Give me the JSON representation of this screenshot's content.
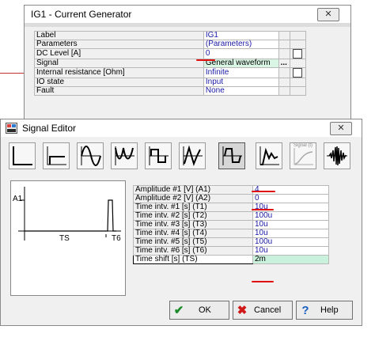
{
  "props_window": {
    "title": "IG1 - Current Generator",
    "rows": [
      {
        "label": "Label",
        "value": "IG1"
      },
      {
        "label": "Parameters",
        "value": "(Parameters)"
      },
      {
        "label": "DC Level [A]",
        "value": "0"
      },
      {
        "label": "Signal",
        "value": "General waveform",
        "more": "..."
      },
      {
        "label": "Internal resistance [Ohm]",
        "value": "Infinite"
      },
      {
        "label": "IO state",
        "value": "Input"
      },
      {
        "label": "Fault",
        "value": "None"
      }
    ]
  },
  "signal_editor": {
    "title": "Signal Editor",
    "waveform_buttons": [
      "step-waveform",
      "ramp-waveform",
      "sine-waveform",
      "full-wave-rectified",
      "square-waveform",
      "triangle-sawtooth-waveform",
      "general-pulse-waveform",
      "damped-waveform",
      "signal-file-waveform",
      "noise-burst-waveform"
    ],
    "signal_file_label": "Signal (t)",
    "active_button": 6,
    "preview": {
      "y_label": "A1",
      "x_label": "TS",
      "x_label_2": "T6"
    },
    "params": [
      {
        "label": "Amplitude #1 [V] (A1)",
        "value": "4"
      },
      {
        "label": "Amplitude #2 [V] (A2)",
        "value": "0"
      },
      {
        "label": "Time intv. #1 [s] (T1)",
        "value": "10u"
      },
      {
        "label": "Time intv. #2 [s] (T2)",
        "value": "100u"
      },
      {
        "label": "Time intv. #3 [s] (T3)",
        "value": "10u"
      },
      {
        "label": "Time intv. #4 [s] (T4)",
        "value": "10u"
      },
      {
        "label": "Time intv. #5 [s] (T5)",
        "value": "100u"
      },
      {
        "label": "Time intv. #6 [s] (T6)",
        "value": "10u"
      },
      {
        "label": "Time shift [s] (TS)",
        "value": "2m"
      }
    ],
    "buttons": {
      "ok": "OK",
      "cancel": "Cancel",
      "help": "Help"
    }
  },
  "colors": {
    "value_text": "#1a1aa6",
    "selected_row": "#c9f1dc",
    "annotation": "#e01010"
  }
}
